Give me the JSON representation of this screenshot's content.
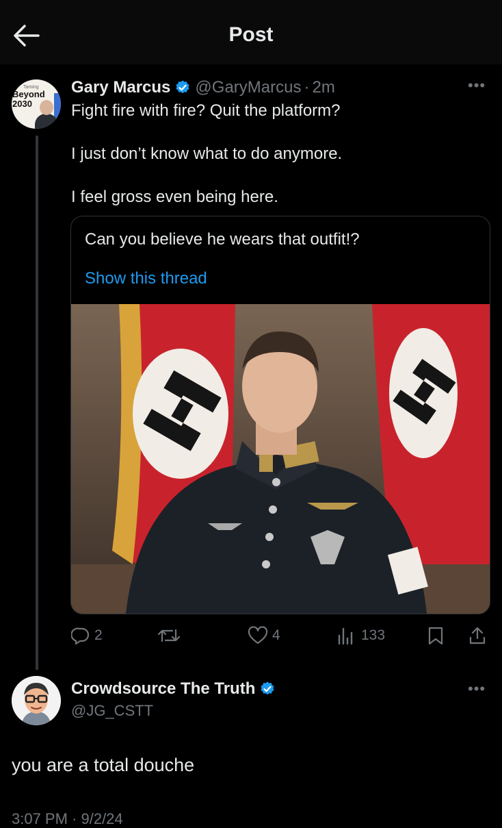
{
  "header": {
    "title": "Post"
  },
  "tweet": {
    "author_name": "Gary Marcus",
    "author_handle": "@GaryMarcus",
    "separator": "·",
    "time": "2m",
    "avatar_caption_small": "Taming",
    "avatar_caption": "Beyond 2030",
    "text_lines": [
      "Fight fire with fire? Quit the platform?",
      "I just don’t know what to do anymore.",
      "I feel gross even being here."
    ],
    "quote": {
      "text": "Can you believe he wears that outfit!?",
      "link": "Show this thread",
      "image_icon": "photo-of-uniformed-man-with-flags"
    },
    "stats": {
      "replies": "2",
      "reposts": "",
      "likes": "4",
      "views": "133"
    }
  },
  "reply": {
    "author_name": "Crowdsource The Truth",
    "author_handle": "@JG_CSTT",
    "text": "you are a total douche",
    "timestamp": "3:07 PM · 9/2/24"
  },
  "colors": {
    "background": "#000000",
    "accent": "#1d9bf0",
    "muted": "#71767b",
    "text": "#e7e9ea"
  }
}
